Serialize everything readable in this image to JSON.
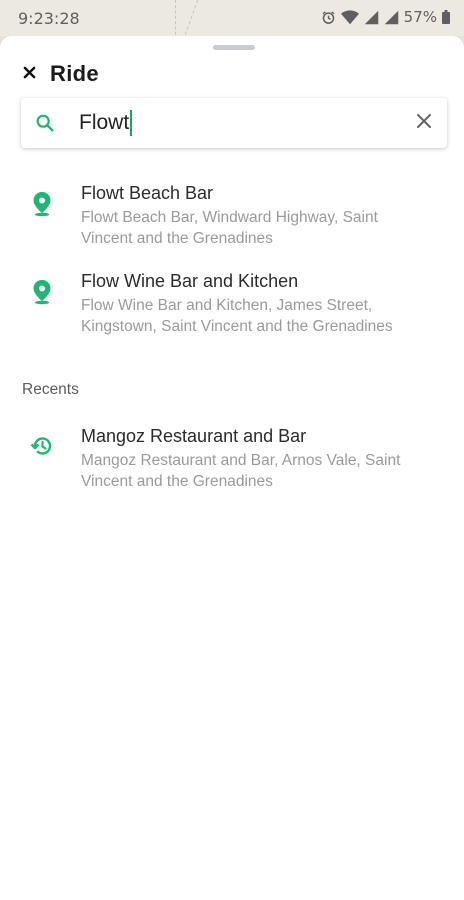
{
  "status_bar": {
    "time": "9:23:28",
    "battery": "57%",
    "icons": [
      "alarm-icon",
      "wifi-icon",
      "signal-icon",
      "signal-icon",
      "battery-icon"
    ]
  },
  "header": {
    "title": "Ride",
    "close_icon": "close-icon"
  },
  "search": {
    "value": "Flowt",
    "search_icon": "search-icon",
    "clear_icon": "clear-icon"
  },
  "results": [
    {
      "title": "Flowt Beach Bar",
      "subtitle": "Flowt Beach Bar, Windward Highway, Saint Vincent and the Grenadines",
      "icon": "location-pin-icon"
    },
    {
      "title": "Flow Wine Bar and Kitchen",
      "subtitle": "Flow Wine Bar and Kitchen, James Street, Kingstown, Saint Vincent and the Grenadines",
      "icon": "location-pin-icon"
    }
  ],
  "recents": {
    "label": "Recents",
    "items": [
      {
        "title": "Mangoz Restaurant and Bar",
        "subtitle": "Mangoz Restaurant and Bar, Arnos Vale, Saint Vincent and the Grenadines",
        "icon": "history-icon"
      }
    ]
  },
  "colors": {
    "accent": "#1fb574",
    "caret": "#1aa56b",
    "background_map": "#e7e3da"
  }
}
